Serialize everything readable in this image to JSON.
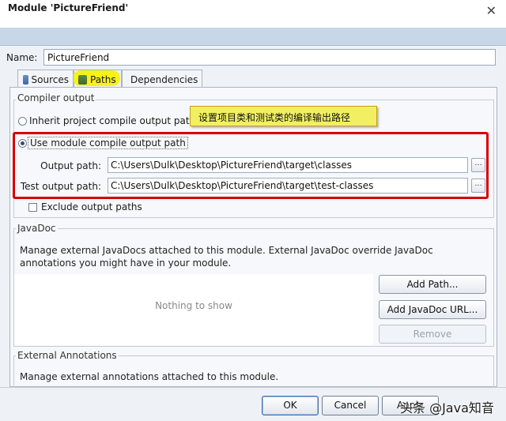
{
  "window": {
    "close_glyph": "✕"
  },
  "header": {
    "title": "Module 'PictureFriend'"
  },
  "name": {
    "label": "Name:",
    "value": "PictureFriend"
  },
  "tabs": [
    {
      "label": "Sources",
      "icon": "sources-icon"
    },
    {
      "label": "Paths",
      "icon": "paths-icon",
      "active": true
    },
    {
      "label": "Dependencies",
      "icon": "dependencies-icon"
    }
  ],
  "compiler_output": {
    "title": "Compiler output",
    "inherit_label": "Inherit project compile output path",
    "module_label": "Use module compile output path",
    "selected": "module",
    "output_path_label": "Output path:",
    "output_path_value": "C:\\Users\\Dulk\\Desktop\\PictureFriend\\target\\classes",
    "test_path_label": "Test output path:",
    "test_path_value": "C:\\Users\\Dulk\\Desktop\\PictureFriend\\target\\test-classes",
    "browse_label": "...",
    "exclude_label": "Exclude output paths",
    "exclude_checked": false
  },
  "annotation": {
    "text": "设置项目类和测试类的编译输出路径"
  },
  "javadoc": {
    "title": "JavaDoc",
    "description": "Manage external JavaDocs attached to this module. External JavaDoc override JavaDoc annotations you might have in your module.",
    "empty_text": "Nothing to show",
    "add_path": "Add Path...",
    "add_javadoc_url": "Add JavaDoc URL...",
    "remove": "Remove"
  },
  "external_annotations": {
    "title": "External Annotations",
    "description": "Manage external annotations attached to this module."
  },
  "buttons": {
    "ok": "OK",
    "cancel": "Cancel",
    "apply": "Apply"
  },
  "watermark": {
    "text": "头条 @Java知音"
  },
  "colors": {
    "highlight": "#f7f218",
    "annotation_bg": "#f2f062",
    "red_box": "#d80000",
    "header_bg": "#c8d7e8"
  }
}
